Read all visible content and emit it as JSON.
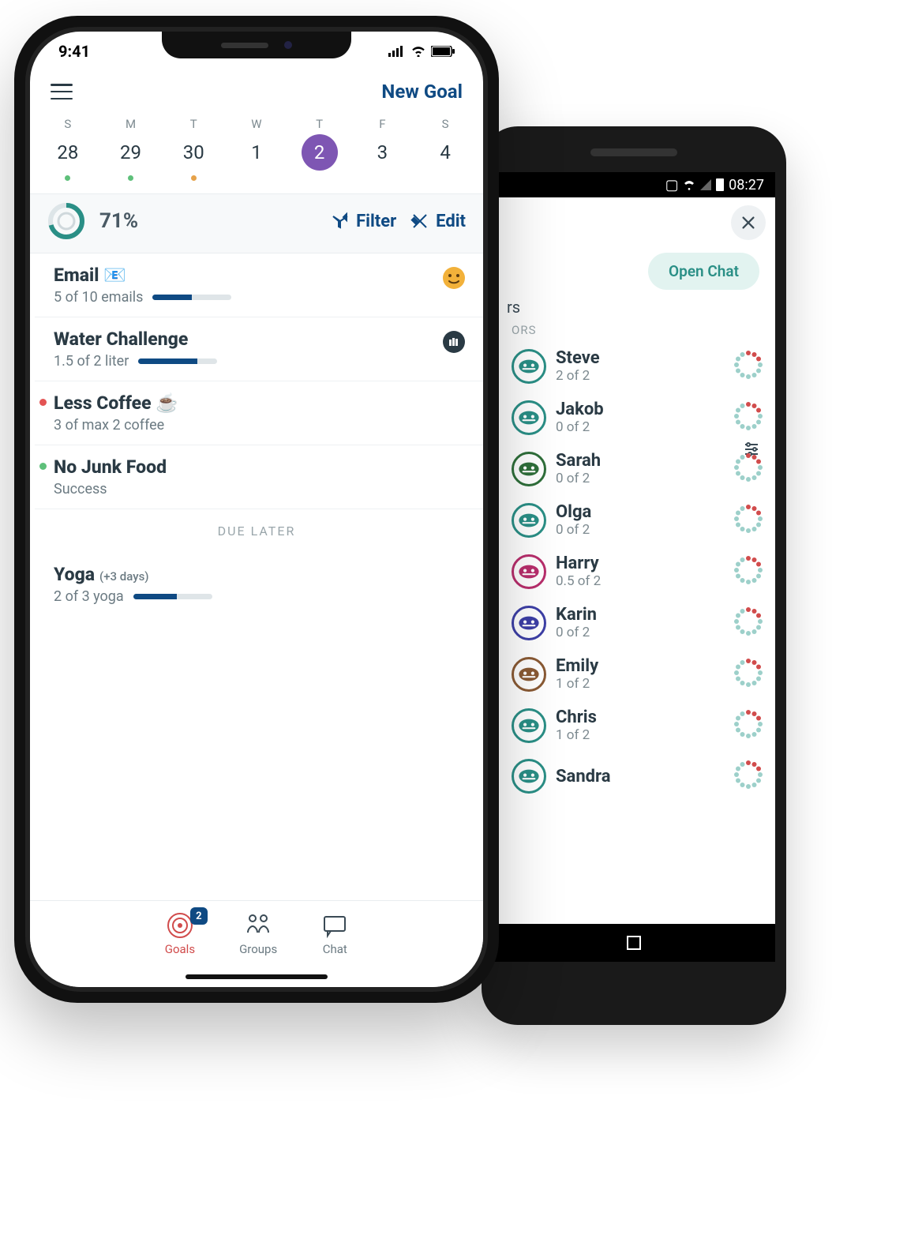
{
  "android": {
    "status_time": "08:27",
    "open_chat": "Open Chat",
    "section": "ORS",
    "members": [
      {
        "name": "Steve",
        "sub": "2 of 2",
        "color": "#2a8f86"
      },
      {
        "name": "Jakob",
        "sub": "0 of 2",
        "color": "#2a8f86"
      },
      {
        "name": "Sarah",
        "sub": "0 of 2",
        "color": "#2f6f3a"
      },
      {
        "name": "Olga",
        "sub": "0 of 2",
        "color": "#2a8f86"
      },
      {
        "name": "Harry",
        "sub": "0.5 of 2",
        "color": "#b82e6c"
      },
      {
        "name": "Karin",
        "sub": "0 of 2",
        "color": "#3d3fa6"
      },
      {
        "name": "Emily",
        "sub": "1 of 2",
        "color": "#8a5a34"
      },
      {
        "name": "Chris",
        "sub": "1 of 2",
        "color": "#2a8f86"
      },
      {
        "name": "Sandra",
        "sub": "",
        "color": "#2a8f86"
      }
    ],
    "rs_label": "rs"
  },
  "iphone": {
    "time": "9:41",
    "top": {
      "new_goal": "New Goal"
    },
    "days": [
      {
        "w": "S",
        "n": "28",
        "dot": "green"
      },
      {
        "w": "M",
        "n": "29",
        "dot": "green"
      },
      {
        "w": "T",
        "n": "30",
        "dot": "orange"
      },
      {
        "w": "W",
        "n": "1",
        "dot": ""
      },
      {
        "w": "T",
        "n": "2",
        "dot": "",
        "sel": true
      },
      {
        "w": "F",
        "n": "3",
        "dot": ""
      },
      {
        "w": "S",
        "n": "4",
        "dot": ""
      }
    ],
    "toolbar": {
      "pct": "71%",
      "filter": "Filter",
      "edit": "Edit"
    },
    "items": [
      {
        "title": "Email 📧",
        "sub": "5 of 10 emails",
        "p": 50,
        "status": "",
        "badge": "smile"
      },
      {
        "title": "Water Challenge",
        "sub": "1.5 of 2 liter",
        "p": 75,
        "status": "",
        "badge": "fist"
      },
      {
        "title": "Less Coffee ☕",
        "sub": "3 of max 2 coffee",
        "p": 0,
        "status": "red"
      },
      {
        "title": "No Junk Food",
        "sub": "Success",
        "p": 0,
        "status": "green"
      }
    ],
    "due": "DUE LATER",
    "later": [
      {
        "title": "Yoga",
        "tag": "(+3 days)",
        "sub": "2 of 3 yoga",
        "p": 55
      }
    ],
    "tabs": [
      {
        "lbl": "Goals",
        "badge": "2",
        "active": true
      },
      {
        "lbl": "Groups"
      },
      {
        "lbl": "Chat"
      }
    ]
  }
}
